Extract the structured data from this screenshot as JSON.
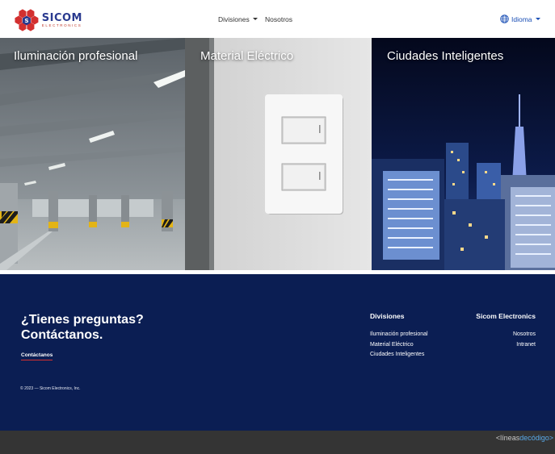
{
  "brand": {
    "name": "SICOM",
    "tagline": "ELECTRONICS",
    "logo_colors": {
      "hex": "#d32f2f",
      "center": "#2a3a8f"
    }
  },
  "nav": {
    "divisiones": "Divisiones",
    "nosotros": "Nosotros",
    "idioma": "Idioma"
  },
  "panels": [
    {
      "title": "Iluminación profesional"
    },
    {
      "title": "Material Eléctrico"
    },
    {
      "title": "Ciudades Inteligentes"
    }
  ],
  "footer": {
    "cta_title": "¿Tienes preguntas? Contáctanos.",
    "cta_link": "Contáctanos",
    "copyright": "© 2023 — Sicom Electronics, Inc.",
    "divisiones": {
      "title": "Divisiones",
      "links": [
        "Iluminación profesional",
        "Material Eléctrico",
        "Ciudades Inteligentes"
      ]
    },
    "sicom": {
      "title": "Sicom Electronics",
      "links": [
        "Nosotros",
        "Intranet"
      ]
    }
  },
  "credit": {
    "prefix": "<líneas",
    "middle": "de",
    "suffix": "código>"
  },
  "colors": {
    "footer_bg": "#0b1e53",
    "accent_red": "#d32f2f",
    "link_blue": "#1a4fb5",
    "bottom_bar": "#343434"
  }
}
